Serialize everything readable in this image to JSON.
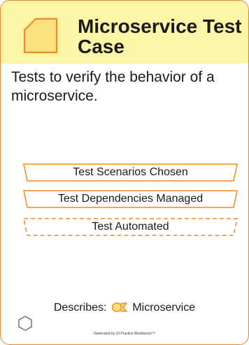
{
  "card": {
    "title": "Microservice Test Case",
    "description": "Tests to verify the behavior of a microservice.",
    "header_color": "#fdf5a6",
    "accent_color": "#f08a24",
    "icon": "work-product-icon"
  },
  "states": [
    {
      "label": "Test Scenarios Chosen",
      "style": "solid"
    },
    {
      "label": "Test Dependencies Managed",
      "style": "solid"
    },
    {
      "label": "Test Automated",
      "style": "dashed"
    }
  ],
  "describes": {
    "prefix": "Describes:",
    "target": "Microservice",
    "icon": "alpha-icon"
  },
  "corner_icon": "hexagon-icon",
  "footer": "Generated by IJI Practice Workbench™"
}
